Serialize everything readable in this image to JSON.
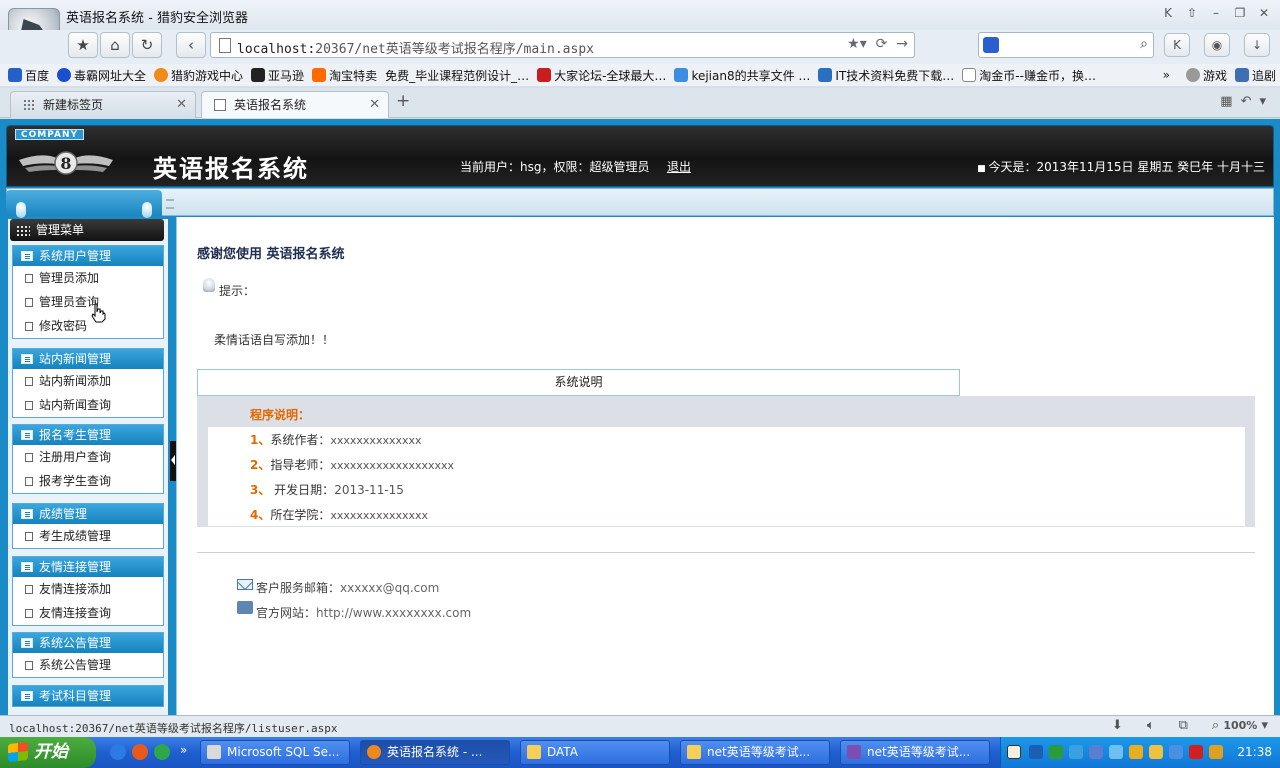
{
  "browser": {
    "window_title": "英语报名系统 - 猎豹安全浏览器",
    "url_host": "localhost:",
    "url_path": "20367/net英语等级考试报名程序/main.aspx",
    "status_url": "localhost:20367/net英语等级考试报名程序/listuser.aspx",
    "zoom": "100%",
    "bookmarks": [
      "百度",
      "毒霸网址大全",
      "猎豹游戏中心",
      "亚马逊",
      "淘宝特卖",
      "免费_毕业课程范例设计_…",
      "大家论坛-全球最大…",
      "kejian8的共享文件 …",
      "IT技术资料免费下载…",
      "淘金币--赚金币，换…"
    ],
    "bookmarks_right": [
      "游戏",
      "追剧"
    ],
    "tabs": [
      {
        "label": "新建标签页"
      },
      {
        "label": "英语报名系统"
      }
    ]
  },
  "site": {
    "company_tag": "COMPANY",
    "title": "英语报名系统",
    "user_info": "当前用户：hsg，权限：超级管理员",
    "logout": "退出",
    "date_info": "今天是：2013年11月15日  星期五  癸巳年  十月十三"
  },
  "sidebar": {
    "menu_title": "管理菜单",
    "groups": [
      {
        "title": "系统用户管理",
        "items": [
          "管理员添加",
          "管理员查询",
          "修改密码"
        ]
      },
      {
        "title": "站内新闻管理",
        "items": [
          "站内新闻添加",
          "站内新闻查询"
        ]
      },
      {
        "title": "报名考生管理",
        "items": [
          "注册用户查询",
          "报考学生查询"
        ]
      },
      {
        "title": "成绩管理",
        "items": [
          "考生成绩管理"
        ]
      },
      {
        "title": "友情连接管理",
        "items": [
          "友情连接添加",
          "友情连接查询"
        ]
      },
      {
        "title": "系统公告管理",
        "items": [
          "系统公告管理"
        ]
      },
      {
        "title": "考试科目管理",
        "items": []
      }
    ]
  },
  "main": {
    "welcome": "感谢您使用 英语报名系统",
    "tip_label": "提示：",
    "tip_text": "柔情话语自写添加！！",
    "section_header": "系统说明",
    "program_title": "程序说明：",
    "program_rows": [
      {
        "num": "1、",
        "label": "系统作者：",
        "value": "xxxxxxxxxxxxxx"
      },
      {
        "num": "2、",
        "label": "指导老师：",
        "value": "xxxxxxxxxxxxxxxxxxx"
      },
      {
        "num": "3、",
        "label": " 开发日期：",
        "value": "2013-11-15"
      },
      {
        "num": "4、",
        "label": "所在学院：",
        "value": "xxxxxxxxxxxxxxx"
      }
    ],
    "footer_email_label": "客户服务邮箱：",
    "footer_email": "xxxxxx@qq.com",
    "footer_site_label": "官方网站：",
    "footer_site": "http://www.xxxxxxxx.com"
  },
  "taskbar": {
    "start_label": "开始",
    "tasks": [
      "Microsoft SQL Se...",
      "英语报名系统 - ...",
      "DATA",
      "net英语等级考试...",
      "net英语等级考试..."
    ],
    "clock": "21:38"
  }
}
